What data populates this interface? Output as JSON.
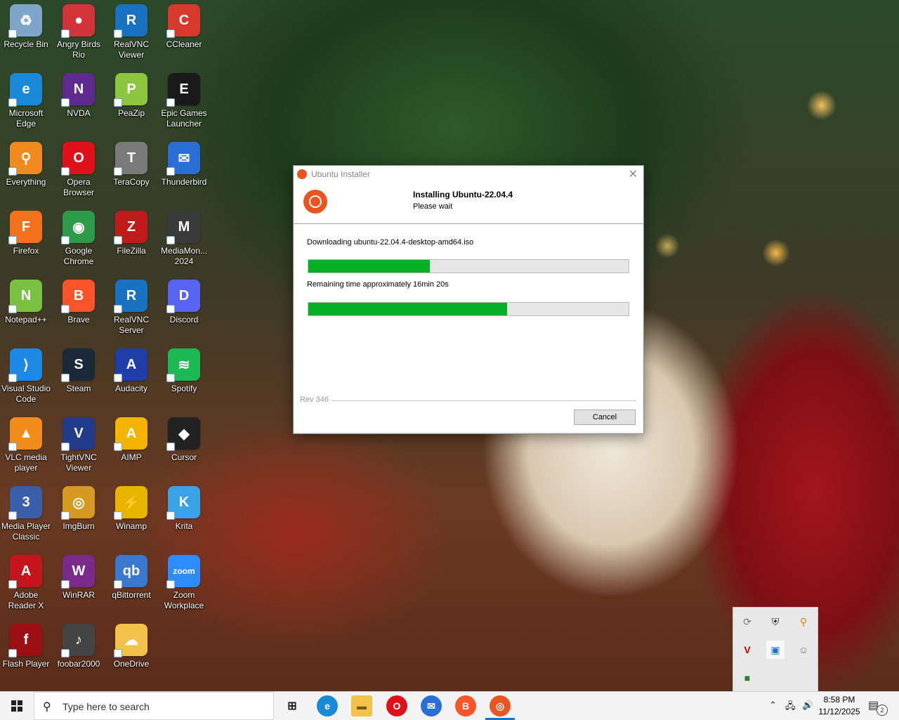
{
  "desktop": {
    "icons": [
      {
        "label": "Recycle Bin",
        "color": "#7fa6c9",
        "glyph": "♻"
      },
      {
        "label": "Angry Birds Rio",
        "color": "#d2343a",
        "glyph": "●"
      },
      {
        "label": "RealVNC Viewer",
        "color": "#1971c2",
        "glyph": "R"
      },
      {
        "label": "CCleaner",
        "color": "#d73a2c",
        "glyph": "C"
      },
      {
        "label": "Microsoft Edge",
        "color": "#1b8ad6",
        "glyph": "e"
      },
      {
        "label": "NVDA",
        "color": "#5e2a8f",
        "glyph": "N"
      },
      {
        "label": "PeaZip",
        "color": "#8dc63f",
        "glyph": "P"
      },
      {
        "label": "Epic Games Launcher",
        "color": "#1a1a1a",
        "glyph": "E"
      },
      {
        "label": "Everything",
        "color": "#f08a1c",
        "glyph": "⚲"
      },
      {
        "label": "Opera Browser",
        "color": "#e0111a",
        "glyph": "O"
      },
      {
        "label": "TeraCopy",
        "color": "#7a7a7a",
        "glyph": "T"
      },
      {
        "label": "Thunderbird",
        "color": "#2a6fd6",
        "glyph": "✉"
      },
      {
        "label": "Firefox",
        "color": "#f2721c",
        "glyph": "F"
      },
      {
        "label": "Google Chrome",
        "color": "#2e9b4a",
        "glyph": "◉"
      },
      {
        "label": "FileZilla",
        "color": "#bf1b1b",
        "glyph": "Z"
      },
      {
        "label": "MediaMon... 2024",
        "color": "#3a3a3a",
        "glyph": "M"
      },
      {
        "label": "Notepad++",
        "color": "#7ac043",
        "glyph": "N"
      },
      {
        "label": "Brave",
        "color": "#fb542b",
        "glyph": "B"
      },
      {
        "label": "RealVNC Server",
        "color": "#1971c2",
        "glyph": "R"
      },
      {
        "label": "Discord",
        "color": "#5865f2",
        "glyph": "D"
      },
      {
        "label": "Visual Studio Code",
        "color": "#1e88e5",
        "glyph": "⟩"
      },
      {
        "label": "Steam",
        "color": "#1b2838",
        "glyph": "S"
      },
      {
        "label": "Audacity",
        "color": "#1f3ea8",
        "glyph": "A"
      },
      {
        "label": "Spotify",
        "color": "#1db954",
        "glyph": "≋"
      },
      {
        "label": "VLC media player",
        "color": "#f28c1a",
        "glyph": "▲"
      },
      {
        "label": "TightVNC Viewer",
        "color": "#203c8a",
        "glyph": "V"
      },
      {
        "label": "AIMP",
        "color": "#f4b400",
        "glyph": "A"
      },
      {
        "label": "Cursor",
        "color": "#222222",
        "glyph": "◆"
      },
      {
        "label": "Media Player Classic",
        "color": "#3a5fa8",
        "glyph": "3"
      },
      {
        "label": "ImgBurn",
        "color": "#d69a23",
        "glyph": "◎"
      },
      {
        "label": "Winamp",
        "color": "#e8b400",
        "glyph": "⚡"
      },
      {
        "label": "Krita",
        "color": "#3aa3e8",
        "glyph": "K"
      },
      {
        "label": "Adobe Reader X",
        "color": "#c5161d",
        "glyph": "A"
      },
      {
        "label": "WinRAR",
        "color": "#7a2a8a",
        "glyph": "W"
      },
      {
        "label": "qBittorrent",
        "color": "#3a78d0",
        "glyph": "qb"
      },
      {
        "label": "Zoom Workplace",
        "color": "#2d8cff",
        "glyph": "zoom"
      },
      {
        "label": "Flash Player",
        "color": "#9b0f15",
        "glyph": "f"
      },
      {
        "label": "foobar2000",
        "color": "#444444",
        "glyph": "♪"
      },
      {
        "label": "OneDrive",
        "color": "#f2c24a",
        "glyph": "☁"
      }
    ]
  },
  "dialog": {
    "title": "Ubuntu Installer",
    "heading": "Installing Ubuntu-22.04.4",
    "subheading": "Please wait",
    "download_text": "Downloading ubuntu-22.04.4-desktop-amd64.iso",
    "remaining_text": "Remaining time approximately 16min 20s",
    "progress1": 0.38,
    "progress2": 0.62,
    "rev": "Rev 346",
    "cancel_label": "Cancel",
    "close_glyph": "✕"
  },
  "taskbar": {
    "search_placeholder": "Type here to search",
    "time": "8:58 PM",
    "date": "11/12/2025",
    "notification_count": "2"
  },
  "colors": {
    "progress": "#06b025",
    "ubuntu": "#e95420",
    "accent": "#0078d4"
  }
}
